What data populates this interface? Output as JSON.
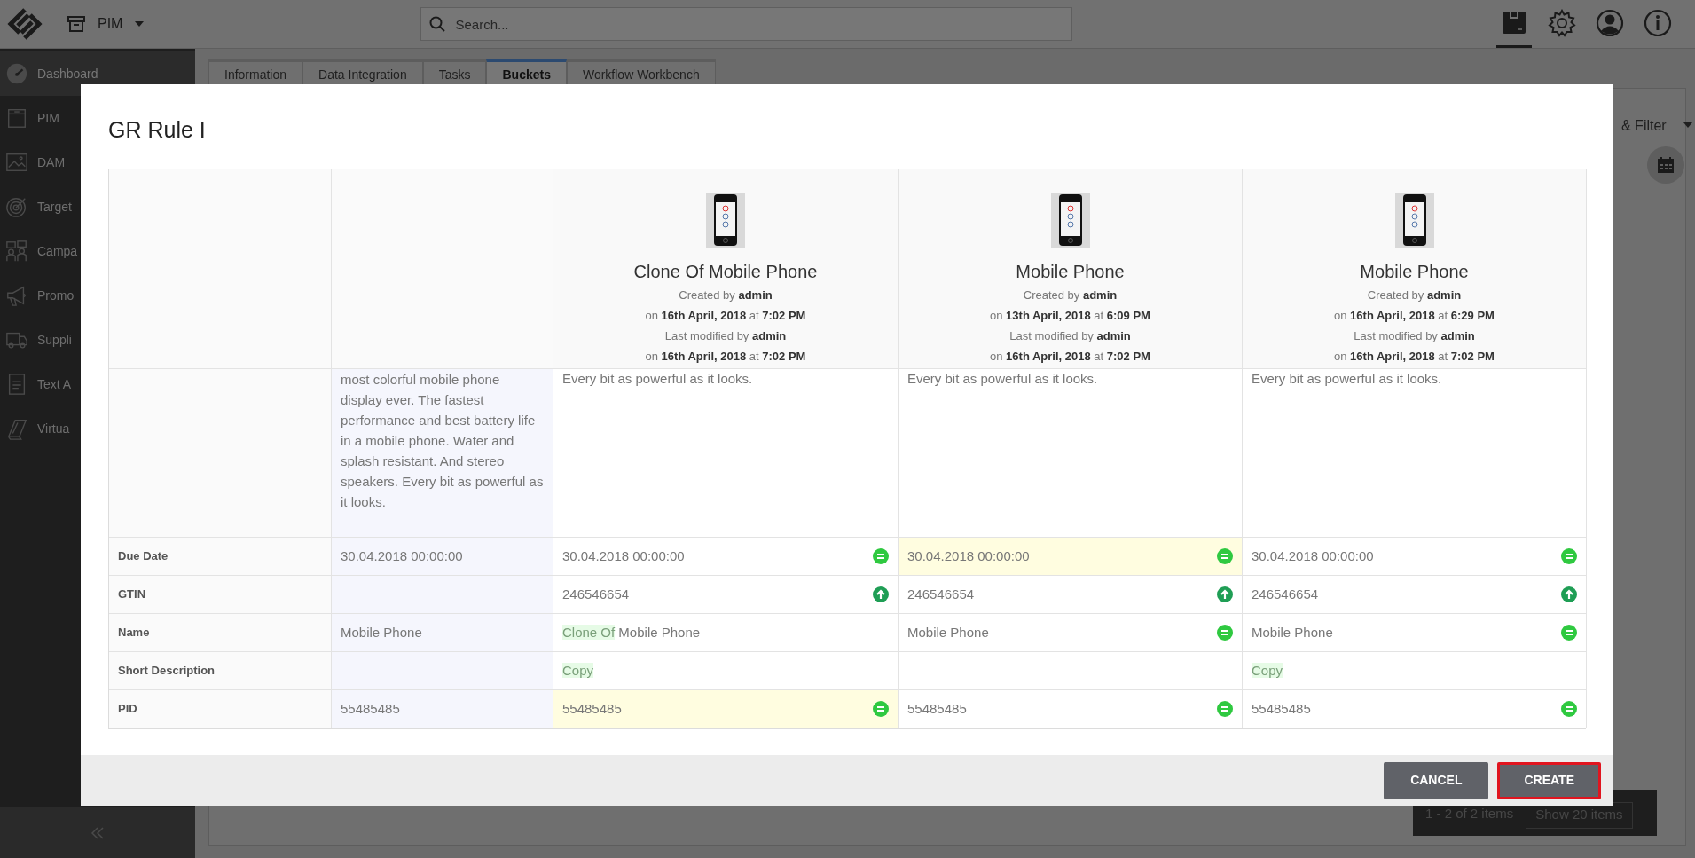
{
  "app_bar": {
    "module": "PIM",
    "search": {
      "placeholder": "Search..."
    },
    "tools": [
      {
        "selected": true
      },
      {
        "selected": false
      },
      {
        "selected": false
      },
      {
        "selected": false
      }
    ]
  },
  "sidebar": {
    "items": [
      {
        "label": "Dashboard",
        "selected": true
      },
      {
        "label": "PIM",
        "selected": false
      },
      {
        "label": "DAM",
        "selected": false
      },
      {
        "label": "Target",
        "selected": false
      },
      {
        "label": "Campa",
        "selected": false
      },
      {
        "label": "Promo",
        "selected": false
      },
      {
        "label": "Suppli",
        "selected": false
      },
      {
        "label": "Text A",
        "selected": false
      },
      {
        "label": "Virtua",
        "selected": false
      }
    ]
  },
  "tabs": [
    {
      "label": "Information",
      "selected": false
    },
    {
      "label": "Data Integration",
      "selected": false
    },
    {
      "label": "Tasks",
      "selected": false
    },
    {
      "label": "Buckets",
      "selected": true
    },
    {
      "label": "Workflow Workbench",
      "selected": false
    }
  ],
  "background": {
    "filter_label": "& Filter",
    "pagination": {
      "range": "1 - 2 of 2 items",
      "page_size": "Show 20 items"
    }
  },
  "modal": {
    "title": "GR Rule I",
    "products": [
      {
        "title": "Clone Of Mobile Phone",
        "meta": [
          "Created by **admin**",
          "on **16th April, 2018** at **7:02 PM**",
          "Last modified by **admin**",
          "on **16th April, 2018** at **7:02 PM**"
        ]
      },
      {
        "title": "Mobile Phone",
        "meta": [
          "Created by **admin**",
          "on **13th April, 2018** at **6:09 PM**",
          "Last modified by **admin**",
          "on **16th April, 2018** at **7:02 PM**"
        ]
      },
      {
        "title": "Mobile Phone",
        "meta": [
          "Created by **admin**",
          "on **16th April, 2018** at **6:29 PM**",
          "Last modified by **admin**",
          "on **16th April, 2018** at **7:02 PM**"
        ]
      }
    ],
    "rows": [
      {
        "kind": "long",
        "base": "most colorful mobile phone display ever. The fastest performance and best battery life in a mobile phone. Water and splash resistant. And stereo speakers. Every bit as powerful as it looks.",
        "cells": [
          {
            "segments": [
              {
                "text": "Every bit as powerful as it looks.",
                "added": false
              }
            ],
            "changed": false
          },
          {
            "segments": [
              {
                "text": "Every bit as powerful as it looks.",
                "added": false
              }
            ],
            "changed": false
          },
          {
            "segments": [
              {
                "text": "Every bit as powerful as it looks.",
                "added": false
              }
            ],
            "changed": false
          }
        ]
      },
      {
        "kind": "short",
        "label": "Due Date",
        "base": "30.04.2018 00:00:00",
        "cells": [
          {
            "segments": [
              {
                "text": "30.04.2018 00:00:00",
                "added": false
              }
            ],
            "changed": false,
            "equal": true
          },
          {
            "segments": [
              {
                "text": "30.04.2018 00:00:00",
                "added": false
              }
            ],
            "changed": true,
            "equal": true
          },
          {
            "segments": [
              {
                "text": "30.04.2018 00:00:00",
                "added": false
              }
            ],
            "changed": false,
            "equal": true
          }
        ]
      },
      {
        "kind": "short",
        "label": "GTIN",
        "cells": [
          {
            "segments": [
              {
                "text": "246546654",
                "added": false
              }
            ],
            "changed": false,
            "updated": true
          },
          {
            "segments": [
              {
                "text": "246546654",
                "added": false
              }
            ],
            "changed": false,
            "updated": true
          },
          {
            "segments": [
              {
                "text": "246546654",
                "added": false
              }
            ],
            "changed": false,
            "updated": true
          }
        ]
      },
      {
        "kind": "short",
        "label": "Name",
        "base": "Mobile Phone",
        "cells": [
          {
            "segments": [
              {
                "text": "Clone Of",
                "added": true
              },
              {
                "text": " Mobile Phone",
                "added": false
              }
            ],
            "changed": false
          },
          {
            "segments": [
              {
                "text": "Mobile Phone",
                "added": false
              }
            ],
            "changed": false,
            "equal": true
          },
          {
            "segments": [
              {
                "text": "Mobile Phone",
                "added": false
              }
            ],
            "changed": false,
            "equal": true
          }
        ]
      },
      {
        "kind": "short",
        "label": "Short Description",
        "cells": [
          {
            "segments": [
              {
                "text": "Copy",
                "added": true
              }
            ],
            "changed": false
          },
          {
            "changed": false
          },
          {
            "segments": [
              {
                "text": "Copy",
                "added": true
              }
            ],
            "changed": false
          }
        ]
      },
      {
        "kind": "short",
        "label": "PID",
        "base": "55485485",
        "cells": [
          {
            "segments": [
              {
                "text": "55485485",
                "added": false
              }
            ],
            "changed": true,
            "equal": true
          },
          {
            "segments": [
              {
                "text": "55485485",
                "added": false
              }
            ],
            "changed": false,
            "equal": true
          },
          {
            "segments": [
              {
                "text": "55485485",
                "added": false
              }
            ],
            "changed": false,
            "equal": true
          }
        ]
      }
    ],
    "buttons": [
      {
        "label": "CANCEL",
        "focused": false
      },
      {
        "label": "CREATE",
        "focused": true
      }
    ]
  }
}
